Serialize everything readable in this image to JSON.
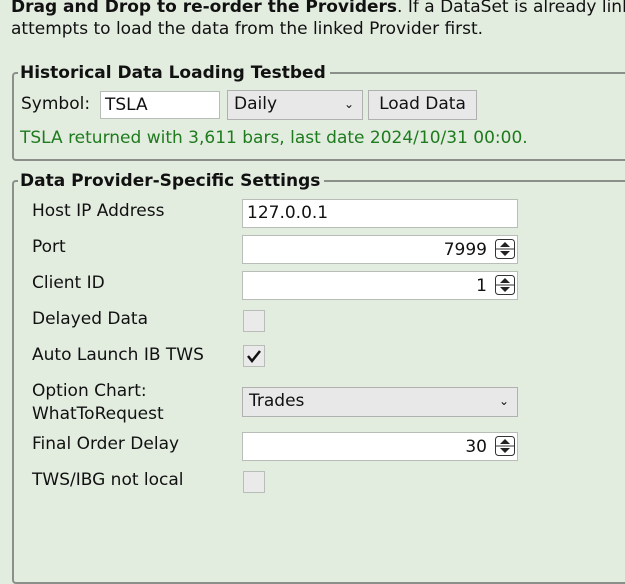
{
  "intro": {
    "bold": "Drag and Drop to re-order the Providers",
    "rest": ". If a DataSet is already linked",
    "line2": "attempts to load the data from the linked Provider first."
  },
  "testbed": {
    "title": "Historical Data Loading Testbed",
    "symbol_label": "Symbol:",
    "symbol_value": "TSLA",
    "interval_value": "Daily",
    "load_button": "Load Data",
    "status": "TSLA returned with 3,611 bars, last date 2024/10/31 00:00.",
    "status_color": "#1e7b1e"
  },
  "settings": {
    "title": "Data Provider-Specific Settings",
    "host_label": "Host IP Address",
    "host_value": "127.0.0.1",
    "port_label": "Port",
    "port_value": "7999",
    "client_label": "Client ID",
    "client_value": "1",
    "delayed_label": "Delayed Data",
    "delayed_checked": false,
    "autolaunch_label": "Auto Launch IB TWS",
    "autolaunch_checked": true,
    "option_label_1": "Option Chart:",
    "option_label_2": "WhatToRequest",
    "option_value": "Trades",
    "delay_label": "Final Order Delay",
    "delay_value": "30",
    "notlocal_label": "TWS/IBG not local",
    "notlocal_checked": false
  }
}
